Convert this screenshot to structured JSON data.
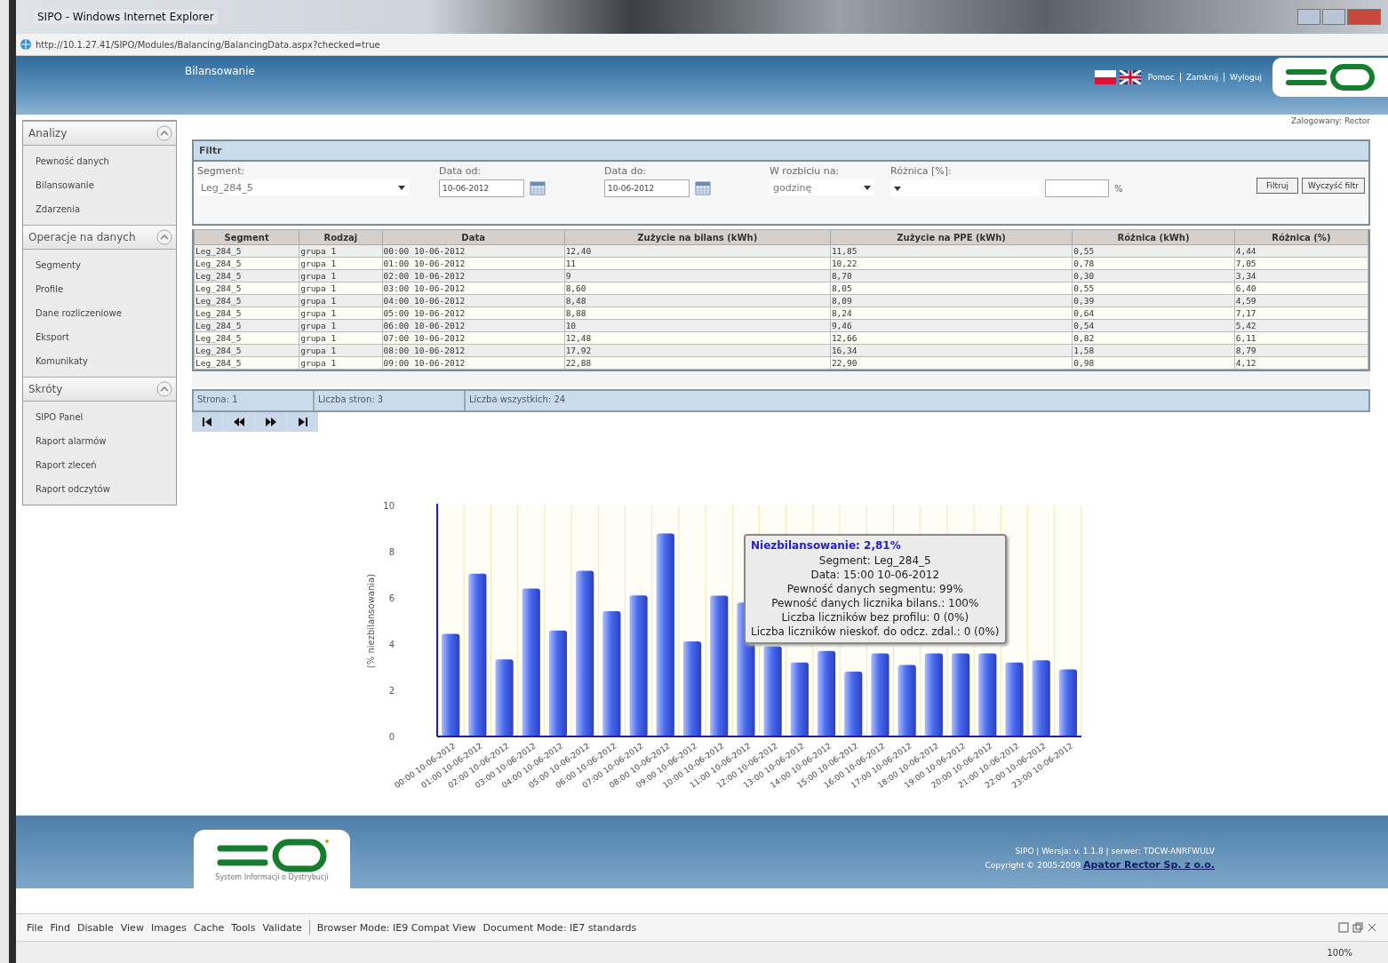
{
  "window": {
    "title": "SIPO - Windows Internet Explorer",
    "address": "http://10.1.27.41/SIPO/Modules/Balancing/BalancingData.aspx?checked=true"
  },
  "header": {
    "title": "Bilansowanie",
    "links": [
      "Pomoc",
      "Zamknij",
      "Wyloguj"
    ],
    "user": "Zalogowany: Rector"
  },
  "sidebar": [
    {
      "title": "Analizy",
      "expanded": true,
      "items": [
        "Pewność danych",
        "Bilansowanie",
        "Zdarzenia"
      ]
    },
    {
      "title": "Operacje na danych",
      "expanded": true,
      "items": [
        "Segmenty",
        "Profile",
        "Dane rozliczeniowe",
        "Eksport",
        "Komunikaty"
      ]
    },
    {
      "title": "Skróty",
      "expanded": true,
      "items": [
        "SIPO Panel",
        "Raport alarmów",
        "Raport zleceń",
        "Raport odczytów"
      ]
    }
  ],
  "filter": {
    "title": "Filtr",
    "fields": [
      {
        "kind": "select",
        "label": "Segment:",
        "value": "Leg_284_5"
      },
      {
        "kind": "date",
        "label": "Data od:",
        "value": "10-06-2012"
      },
      {
        "kind": "date",
        "label": "Data do:",
        "value": "10-06-2012"
      },
      {
        "kind": "select",
        "label": "W rozbiciu na:",
        "value": "godzinę"
      },
      {
        "kind": "percent",
        "label": "Różnica [%]:",
        "unit": "%"
      }
    ],
    "buttons": [
      "Filtruj",
      "Wyczyść filtr"
    ]
  },
  "table": {
    "columns": [
      "Segment",
      "Rodzaj",
      "Data",
      "Zużycie na bilans (kWh)",
      "Zużycie na PPE (kWh)",
      "Różnica (kWh)",
      "Różnica (%)"
    ],
    "rows": [
      [
        "Leg_284_5",
        "grupa 1",
        "00:00 10-06-2012",
        "12,40",
        "11,85",
        "0,55",
        "4,44"
      ],
      [
        "Leg_284_5",
        "grupa 1",
        "01:00 10-06-2012",
        "11",
        "10,22",
        "0,78",
        "7,05"
      ],
      [
        "Leg_284_5",
        "grupa 1",
        "02:00 10-06-2012",
        "9",
        "8,70",
        "0,30",
        "3,34"
      ],
      [
        "Leg_284_5",
        "grupa 1",
        "03:00 10-06-2012",
        "8,60",
        "8,05",
        "0,55",
        "6,40"
      ],
      [
        "Leg_284_5",
        "grupa 1",
        "04:00 10-06-2012",
        "8,48",
        "8,09",
        "0,39",
        "4,59"
      ],
      [
        "Leg_284_5",
        "grupa 1",
        "05:00 10-06-2012",
        "8,88",
        "8,24",
        "0,64",
        "7,17"
      ],
      [
        "Leg_284_5",
        "grupa 1",
        "06:00 10-06-2012",
        "10",
        "9,46",
        "0,54",
        "5,42"
      ],
      [
        "Leg_284_5",
        "grupa 1",
        "07:00 10-06-2012",
        "12,48",
        "12,66",
        "0,82",
        "6,11"
      ],
      [
        "Leg_284_5",
        "grupa 1",
        "08:00 10-06-2012",
        "17,92",
        "16,34",
        "1,58",
        "8,79"
      ],
      [
        "Leg_284_5",
        "grupa 1",
        "09:00 10-06-2012",
        "22,88",
        "22,90",
        "0,98",
        "4,12"
      ]
    ]
  },
  "pager": {
    "info": [
      "Strona: 1",
      "Liczba stron: 3",
      "Liczba wszystkich: 24"
    ]
  },
  "chart": {
    "chart_data": {
      "type": "bar",
      "ylabel": "(% niezbilansowania)",
      "ylim": [
        0,
        10
      ],
      "yticks": [
        0,
        2,
        4,
        6,
        8,
        10
      ],
      "categories": [
        "00:00 10-06-2012",
        "01:00 10-06-2012",
        "02:00 10-06-2012",
        "03:00 10-06-2012",
        "04:00 10-06-2012",
        "05:00 10-06-2012",
        "06:00 10-06-2012",
        "07:00 10-06-2012",
        "08:00 10-06-2012",
        "09:00 10-06-2012",
        "10:00 10-06-2012",
        "11:00 10-06-2012",
        "12:00 10-06-2012",
        "13:00 10-06-2012",
        "14:00 10-06-2012",
        "15:00 10-06-2012",
        "16:00 10-06-2012",
        "17:00 10-06-2012",
        "18:00 10-06-2012",
        "19:00 10-06-2012",
        "20:00 10-06-2012",
        "21:00 10-06-2012",
        "22:00 10-06-2012",
        "23:00 10-06-2012"
      ],
      "series": [
        {
          "color": "#4a6cf0",
          "values": [
            4.44,
            7.05,
            3.34,
            6.4,
            4.59,
            7.17,
            5.42,
            6.11,
            8.79,
            4.12,
            6.1,
            5.8,
            3.9,
            3.2,
            3.7,
            2.81,
            3.6,
            3.1,
            3.6,
            3.6,
            3.6,
            3.2,
            3.3,
            2.9
          ]
        }
      ]
    },
    "tooltip": {
      "title": "Niezbilansowanie: 2,81%",
      "lines": [
        "Segment: Leg_284_5",
        "Data: 15:00 10-06-2012",
        "Pewność danych segmentu: 99%",
        "Pewność danych licznika bilans.: 100%",
        "Liczba liczników bez profilu: 0 (0%)",
        "Liczba liczników nieskof. do odcz. zdal.: 0 (0%)"
      ]
    }
  },
  "footer": {
    "tagline": "System Informacji o Dystrybucji",
    "version": "SIPO | Wersja: v. 1.1.8 | serwer: TDCW-ANRFWULV",
    "copyright": "Copyright © 2005-2009",
    "company": "Apator Rector Sp. z o.o."
  },
  "devtools": {
    "menu": [
      "File",
      "Find",
      "Disable",
      "View",
      "Images",
      "Cache",
      "Tools",
      "Validate"
    ],
    "modes": [
      "Browser Mode: IE9 Compat View",
      "Document Mode: IE7 standards"
    ]
  },
  "status_bar": {
    "zoom": "100%"
  }
}
